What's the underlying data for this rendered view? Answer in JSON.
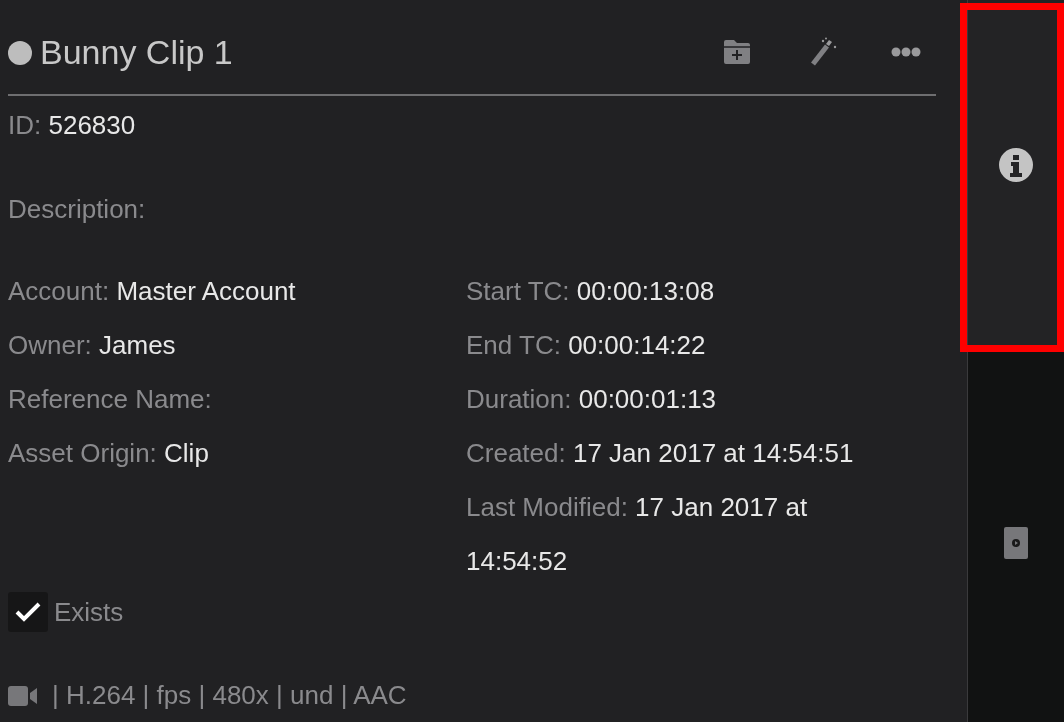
{
  "header": {
    "title": "Bunny Clip 1"
  },
  "id": {
    "label": "ID:",
    "value": "526830"
  },
  "description": {
    "label": "Description:"
  },
  "left_fields": [
    {
      "label": "Account:",
      "value": "Master Account"
    },
    {
      "label": "Owner:",
      "value": "James"
    },
    {
      "label": "Reference Name:"
    },
    {
      "label": "Asset Origin:",
      "value": "Clip"
    }
  ],
  "right_fields": [
    {
      "label": "Start TC:",
      "value": "00:00:13:08"
    },
    {
      "label": "End TC:",
      "value": "00:00:14:22"
    },
    {
      "label": "Duration:",
      "value": "00:00:01:13"
    },
    {
      "label": "Created:",
      "value": "17 Jan 2017 at 14:54:51"
    },
    {
      "label": "Last Modified:",
      "value": "17 Jan 2017 at 14:54:52"
    }
  ],
  "exists": {
    "label": "Exists",
    "checked": true
  },
  "media_info": "| H.264 | fps | 480x | und | AAC",
  "sidebar": {
    "tabs": [
      {
        "kind": "info",
        "selected": true
      },
      {
        "kind": "media",
        "selected": false
      }
    ]
  }
}
